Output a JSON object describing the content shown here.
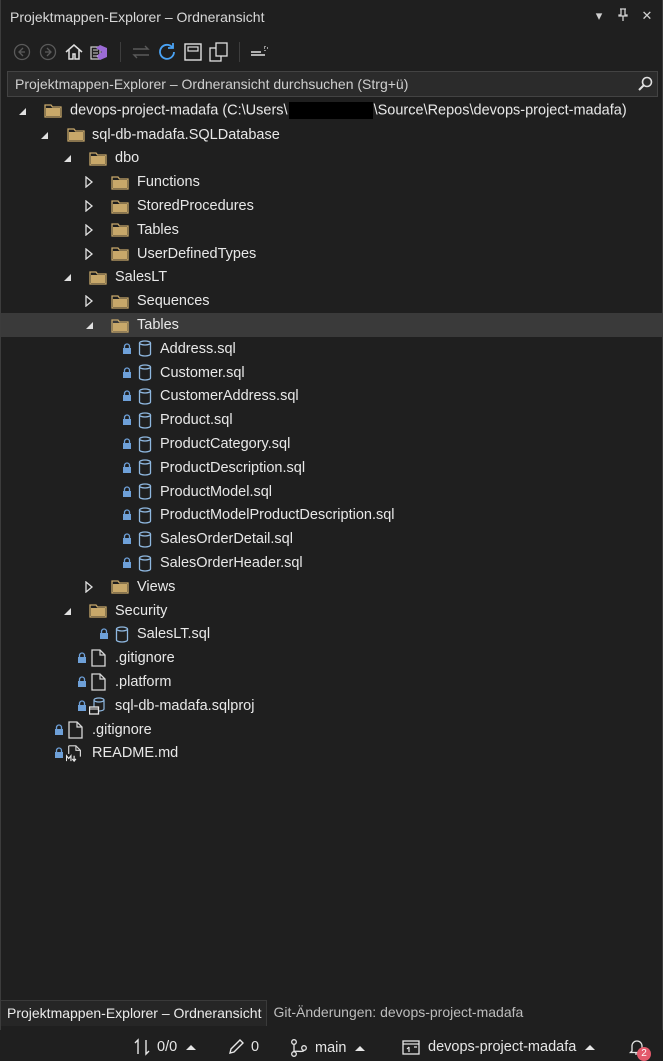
{
  "window": {
    "title": "Projektmappen-Explorer – Ordneransicht"
  },
  "toolbar": {
    "icons": [
      "back-icon",
      "forward-icon",
      "home-icon",
      "vs-switch-view-icon",
      "sync-icon",
      "refresh-icon",
      "collapse-all-icon",
      "show-all-files-icon",
      "properties-icon"
    ]
  },
  "search": {
    "placeholder": "Projektmappen-Explorer – Ordneransicht durchsuchen (Strg+ü)"
  },
  "tree": {
    "root": {
      "label_prefix": "devops-project-madafa (C:\\Users\\",
      "label_suffix": "\\Source\\Repos\\devops-project-madafa)"
    },
    "project": "sql-db-madafa.SQLDatabase",
    "dbo": "dbo",
    "dbo_children": [
      "Functions",
      "StoredProcedures",
      "Tables",
      "UserDefinedTypes"
    ],
    "saleslt": "SalesLT",
    "sequences": "Sequences",
    "tables": "Tables",
    "table_files": [
      "Address.sql",
      "Customer.sql",
      "CustomerAddress.sql",
      "Product.sql",
      "ProductCategory.sql",
      "ProductDescription.sql",
      "ProductModel.sql",
      "ProductModelProductDescription.sql",
      "SalesOrderDetail.sql",
      "SalesOrderHeader.sql"
    ],
    "views": "Views",
    "security": "Security",
    "security_file": "SalesLT.sql",
    "project_files": [
      ".gitignore",
      ".platform",
      "sql-db-madafa.sqlproj"
    ],
    "root_files": [
      ".gitignore",
      "README.md"
    ]
  },
  "bottom_tabs": {
    "active": "Projektmappen-Explorer – Ordneransicht",
    "other": "Git-Änderungen: devops-project-madafa"
  },
  "statusbar": {
    "sync": "0/0",
    "changes": "0",
    "branch": "main",
    "repo": "devops-project-madafa",
    "notifications": "2"
  },
  "colors": {
    "folder": "#c8a86a",
    "db_icon": "#8fb8e0",
    "lock": "#6ea0d8",
    "selected_row": "#3a3a3a",
    "badge": "#e35a6c"
  }
}
